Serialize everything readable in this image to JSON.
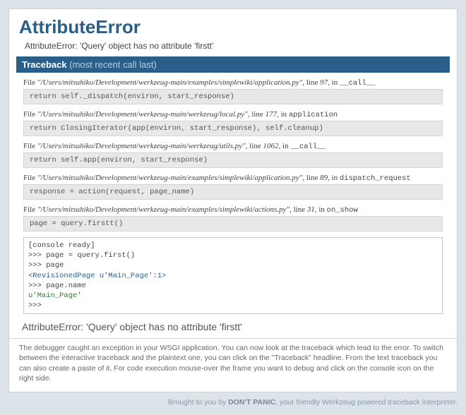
{
  "title": "AttributeError",
  "exception_value": "AttributeError: 'Query' object has no attribute 'firstt'",
  "traceback_header_label": "Traceback",
  "traceback_header_note": "(most recent call last)",
  "frames": [
    {
      "file_prefix": "File ",
      "path": "\"/Users/mitsuhiko/Development/werkzeug-main/examples/simplewiki/application.py\"",
      "line_prefix": ", line ",
      "lineno": "97",
      "in_prefix": ", in ",
      "func": "__call__",
      "code": "return self._dispatch(environ, start_response)"
    },
    {
      "file_prefix": "File ",
      "path": "\"/Users/mitsuhiko/Development/werkzeug-main/werkzeug/local.py\"",
      "line_prefix": ", line ",
      "lineno": "177",
      "in_prefix": ", in ",
      "func": "application",
      "code": "return ClosingIterator(app(environ, start_response), self.cleanup)"
    },
    {
      "file_prefix": "File ",
      "path": "\"/Users/mitsuhiko/Development/werkzeug-main/werkzeug/utils.py\"",
      "line_prefix": ", line ",
      "lineno": "1062",
      "in_prefix": ", in ",
      "func": "__call__",
      "code": "return self.app(environ, start_response)"
    },
    {
      "file_prefix": "File ",
      "path": "\"/Users/mitsuhiko/Development/werkzeug-main/examples/simplewiki/application.py\"",
      "line_prefix": ", line ",
      "lineno": "89",
      "in_prefix": ", in ",
      "func": "dispatch_request",
      "code": "response = action(request, page_name)"
    },
    {
      "file_prefix": "File ",
      "path": "\"/Users/mitsuhiko/Development/werkzeug-main/examples/simplewiki/actions.py\"",
      "line_prefix": ", line ",
      "lineno": "31",
      "in_prefix": ", in ",
      "func": "on_show",
      "code": "page = query.firstt()"
    }
  ],
  "console": {
    "ready": "[console ready]",
    "p1": ">>> page = query.first()",
    "p2": ">>> page",
    "r2": "<RevisionedPage u'Main_Page':1>",
    "p3": ">>> page.name",
    "r3": "u'Main_Page'",
    "p4": ">>>"
  },
  "bottom_exception": "AttributeError: 'Query' object has no attribute 'firstt'",
  "explain": "The debugger caught an exception in your WSGI application. You can now look at the traceback which lead to the error. To switch between the interactive traceback and the plaintext one, you can click on the \"Traceback\" headline. From the text traceback you can also create a paste of it. For code execution mouse-over the frame you want to debug and click on the console icon on the right side.",
  "footer_prefix": "Brought to you by ",
  "footer_brand": "DON'T PANIC",
  "footer_suffix": ", your friendly Werkzeug powered traceback interpreter."
}
